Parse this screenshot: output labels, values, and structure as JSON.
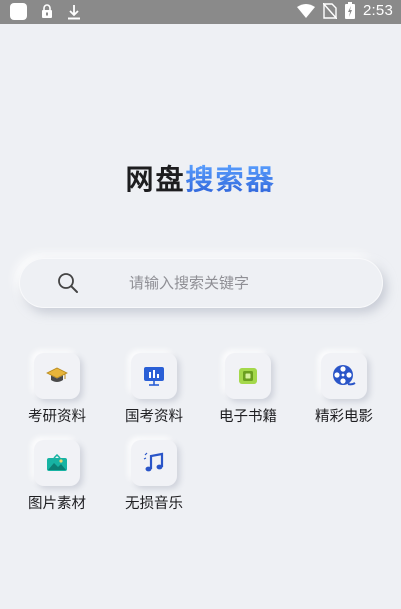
{
  "status_bar": {
    "time": "2:53",
    "icons": [
      "app-square-icon",
      "lock-icon",
      "download-icon",
      "wifi-icon",
      "no-sim-icon",
      "battery-charging-icon"
    ]
  },
  "title": {
    "part1": "网盘",
    "part2": "搜索器",
    "color_dark": "#1d1d1f",
    "color_blue": "#3a7bea"
  },
  "search": {
    "placeholder": "请输入搜索关键字",
    "value": ""
  },
  "categories": [
    {
      "label": "考研资料",
      "icon": "graduation-cap-icon"
    },
    {
      "label": "国考资料",
      "icon": "presentation-chart-icon"
    },
    {
      "label": "电子书籍",
      "icon": "ebook-icon"
    },
    {
      "label": "精彩电影",
      "icon": "film-reel-icon"
    },
    {
      "label": "图片素材",
      "icon": "image-icon"
    },
    {
      "label": "无损音乐",
      "icon": "music-note-icon"
    }
  ]
}
